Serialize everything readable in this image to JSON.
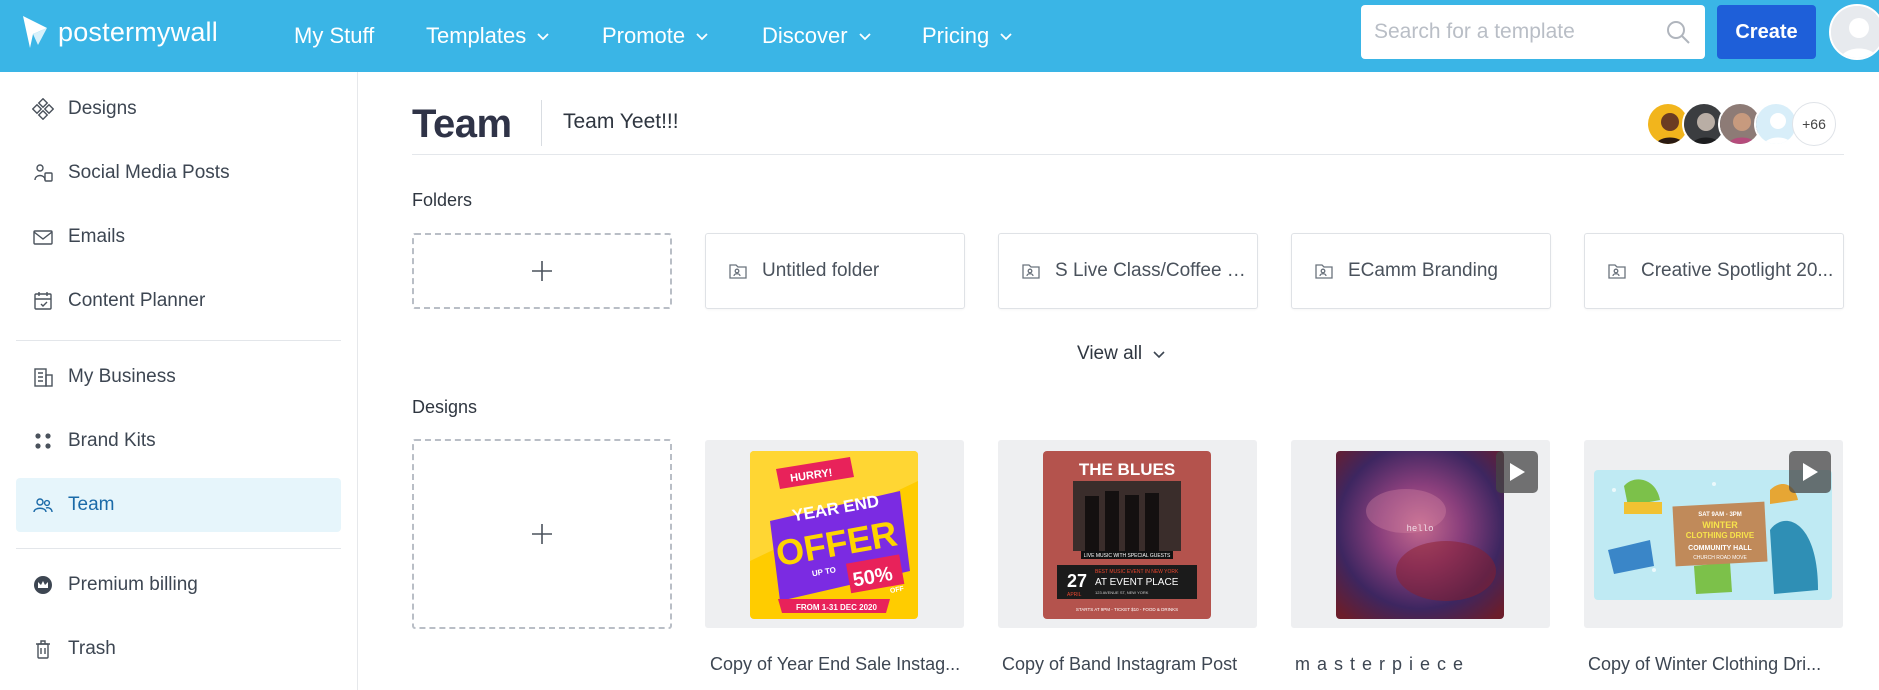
{
  "brand": {
    "name": "postermywall"
  },
  "nav": {
    "my_stuff": "My Stuff",
    "templates": "Templates",
    "promote": "Promote",
    "discover": "Discover",
    "pricing": "Pricing"
  },
  "search": {
    "placeholder": "Search for a template"
  },
  "create_label": "Create",
  "sidebar": {
    "items": [
      {
        "label": "Designs",
        "icon": "designs-icon"
      },
      {
        "label": "Social Media Posts",
        "icon": "social-media-icon"
      },
      {
        "label": "Emails",
        "icon": "email-icon"
      },
      {
        "label": "Content Planner",
        "icon": "calendar-icon"
      },
      {
        "label": "My Business",
        "icon": "building-icon"
      },
      {
        "label": "Brand Kits",
        "icon": "brand-kit-icon"
      },
      {
        "label": "Team",
        "icon": "team-icon",
        "active": true
      },
      {
        "label": "Premium billing",
        "icon": "crown-icon"
      },
      {
        "label": "Trash",
        "icon": "trash-icon"
      }
    ]
  },
  "header": {
    "title": "Team",
    "team_name": "Team Yeet!!!",
    "member_overflow": "+66"
  },
  "folders": {
    "label": "Folders",
    "items": [
      {
        "name": "Untitled folder"
      },
      {
        "name": "S Live Class/Coffee Br..."
      },
      {
        "name": "ECamm Branding"
      },
      {
        "name": "Creative Spotlight 20..."
      }
    ],
    "view_all": "View all"
  },
  "designs": {
    "label": "Designs",
    "items": [
      {
        "name": "Copy of Year End Sale Instag..."
      },
      {
        "name": "Copy of Band Instagram Post"
      },
      {
        "name": "m a s t e r p i e c e"
      },
      {
        "name": "Copy of Winter Clothing Dri..."
      }
    ],
    "thumb_text": {
      "hurry": "HURRY!",
      "year_end": "YEAR END",
      "offer": "OFFER",
      "up_to": "UP TO",
      "fifty": "50%",
      "off": "OFF",
      "dates": "FROM 1-31 DEC 2020",
      "the_blues": "THE BLUES",
      "live_music": "LIVE MUSIC WITH SPECIAL GUESTS",
      "day": "27",
      "month": "APRIL",
      "best_music": "BEST MUSIC EVENT IN NEW YORK",
      "at_event": "AT EVENT PLACE",
      "address": "123 AVENUE ST, NEW YORK",
      "tickets": "STARTS AT 9PM - TICKET $10 - FOOD & DRINKS",
      "hello": "hello",
      "hours": "SAT 9AM - 3PM",
      "winter": "WINTER",
      "clothing_drive": "CLOTHING DRIVE",
      "community_hall": "COMMUNITY HALL",
      "church_road": "CHURCH ROAD MOVE"
    }
  },
  "colors": {
    "topbar": "#3ab5e6",
    "create": "#1e5fd9",
    "active_bg": "#e6f5fb",
    "active_text": "#1b6aa8"
  }
}
